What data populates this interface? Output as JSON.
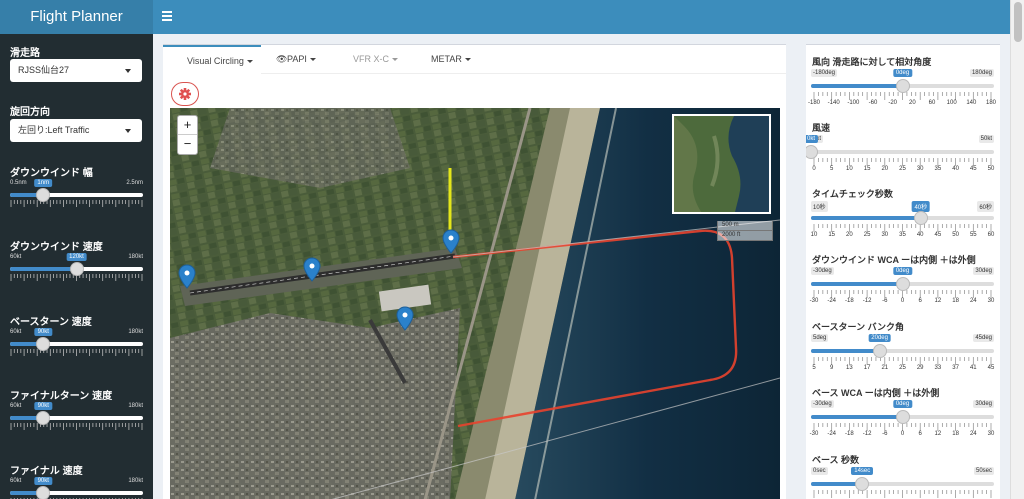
{
  "app": {
    "title": "Flight Planner"
  },
  "sidebar": {
    "runway": {
      "label": "滑走路",
      "value": "RJSS仙台27"
    },
    "direction": {
      "label": "旋回方向",
      "value": "左回り:Left Traffic"
    },
    "sliders": [
      {
        "label": "ダウンウインド 幅",
        "min": "0.5nm",
        "max": "2.5nm",
        "value": "1nm",
        "fraction": 0.25
      },
      {
        "label": "ダウンウインド 速度",
        "min": "60kt",
        "max": "180kt",
        "value": "120kt",
        "fraction": 0.5
      },
      {
        "label": "ベースターン 速度",
        "min": "60kt",
        "max": "180kt",
        "value": "90kt",
        "fraction": 0.25
      },
      {
        "label": "ファイナルターン 速度",
        "min": "60kt",
        "max": "180kt",
        "value": "90kt",
        "fraction": 0.25
      },
      {
        "label": "ファイナル 速度",
        "min": "60kt",
        "max": "180kt",
        "value": "90kt",
        "fraction": 0.25
      }
    ]
  },
  "tabs": [
    {
      "icon": "",
      "label": "Visual Circling",
      "active": true
    },
    {
      "icon": "👁",
      "label": "PAPI",
      "active": false
    },
    {
      "icon": "",
      "label": "VFR X-C",
      "active": false,
      "disabled": true
    },
    {
      "icon": "",
      "label": "METAR",
      "active": false
    }
  ],
  "map": {
    "scale_m": "500 m",
    "scale_ft": "2000 ft",
    "zoom_in": "+",
    "zoom_out": "−"
  },
  "right_panel": {
    "sliders": [
      {
        "label": "風向 滑走路に対して相対角度",
        "min": "-180deg",
        "max": "180deg",
        "value": "0deg",
        "fraction": 0.5,
        "ticks": [
          "-180",
          "-140",
          "-100",
          "-60",
          "-20",
          "20",
          "60",
          "100",
          "140",
          "180"
        ]
      },
      {
        "label": "風速",
        "min": "0kt",
        "max": "50kt",
        "value": "0kt",
        "fraction": 0.0,
        "ticks": [
          "0",
          "5",
          "10",
          "15",
          "20",
          "25",
          "30",
          "35",
          "40",
          "45",
          "50"
        ]
      },
      {
        "label": "タイムチェック秒数",
        "min": "10秒",
        "max": "60秒",
        "value": "40秒",
        "fraction": 0.6,
        "ticks": [
          "10",
          "15",
          "20",
          "25",
          "30",
          "35",
          "40",
          "45",
          "50",
          "55",
          "60"
        ]
      },
      {
        "label": "ダウンウインド WCA ーは内側 ＋は外側",
        "min": "-30deg",
        "max": "30deg",
        "value": "0deg",
        "fraction": 0.5,
        "ticks": [
          "-30",
          "-24",
          "-18",
          "-12",
          "-6",
          "0",
          "6",
          "12",
          "18",
          "24",
          "30"
        ]
      },
      {
        "label": "ベースターン バンク角",
        "min": "5deg",
        "max": "45deg",
        "value": "20deg",
        "fraction": 0.375,
        "ticks": [
          "5",
          "9",
          "13",
          "17",
          "21",
          "25",
          "29",
          "33",
          "37",
          "41",
          "45"
        ]
      },
      {
        "label": "ベース WCA ーは内側 ＋は外側",
        "min": "-30deg",
        "max": "30deg",
        "value": "0deg",
        "fraction": 0.5,
        "ticks": [
          "-30",
          "-24",
          "-18",
          "-12",
          "-6",
          "0",
          "6",
          "12",
          "18",
          "24",
          "30"
        ]
      },
      {
        "label": "ベース 秒数",
        "min": "0sec",
        "max": "50sec",
        "value": "14sec",
        "fraction": 0.28,
        "ticks": []
      }
    ]
  },
  "colors": {
    "header": "#3c8dbc",
    "logo": "#367fa9",
    "sidebar": "#222d32",
    "accent": "#428bca",
    "route": "#e8432d",
    "marker": "#2a81cb"
  }
}
